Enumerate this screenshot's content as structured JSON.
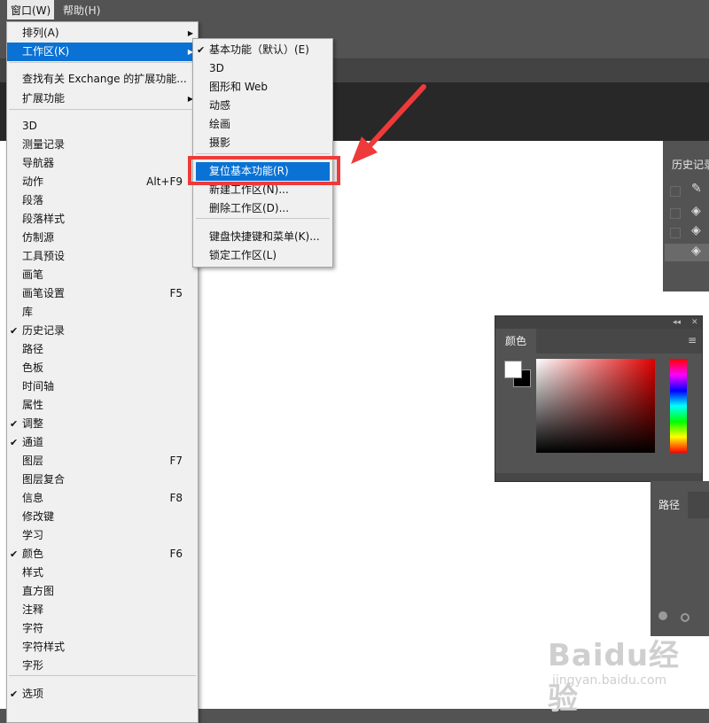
{
  "menubar": {
    "window": "窗口(W)",
    "help": "帮助(H)"
  },
  "window_menu": [
    {
      "label": "排列(A)",
      "submenu": true
    },
    {
      "label": "工作区(K)",
      "submenu": true,
      "highlighted": true
    },
    {
      "label": "查找有关 Exchange 的扩展功能..."
    },
    {
      "label": "扩展功能",
      "submenu": true
    },
    {
      "label": "3D"
    },
    {
      "label": "测量记录"
    },
    {
      "label": "导航器"
    },
    {
      "label": "动作",
      "shortcut": "Alt+F9"
    },
    {
      "label": "段落"
    },
    {
      "label": "段落样式"
    },
    {
      "label": "仿制源"
    },
    {
      "label": "工具预设"
    },
    {
      "label": "画笔"
    },
    {
      "label": "画笔设置",
      "shortcut": "F5"
    },
    {
      "label": "库"
    },
    {
      "label": "历史记录",
      "checked": true
    },
    {
      "label": "路径"
    },
    {
      "label": "色板"
    },
    {
      "label": "时间轴"
    },
    {
      "label": "属性"
    },
    {
      "label": "调整",
      "checked": true
    },
    {
      "label": "通道",
      "checked": true
    },
    {
      "label": "图层",
      "shortcut": "F7"
    },
    {
      "label": "图层复合"
    },
    {
      "label": "信息",
      "shortcut": "F8"
    },
    {
      "label": "修改键"
    },
    {
      "label": "学习"
    },
    {
      "label": "颜色",
      "shortcut": "F6",
      "checked": true
    },
    {
      "label": "样式"
    },
    {
      "label": "直方图"
    },
    {
      "label": "注释"
    },
    {
      "label": "字符"
    },
    {
      "label": "字符样式"
    },
    {
      "label": "字形"
    },
    {
      "label": "选项",
      "checked": true
    }
  ],
  "workspace_submenu": [
    {
      "label": "基本功能（默认）(E)",
      "checked": true
    },
    {
      "label": "3D"
    },
    {
      "label": "图形和 Web"
    },
    {
      "label": "动感"
    },
    {
      "label": "绘画"
    },
    {
      "label": "摄影"
    },
    {
      "label": "复位基本功能(R)",
      "highlighted": true
    },
    {
      "label": "新建工作区(N)..."
    },
    {
      "label": "删除工作区(D)..."
    },
    {
      "label": "键盘快捷键和菜单(K)..."
    },
    {
      "label": "锁定工作区(L)"
    }
  ],
  "panels": {
    "history": {
      "title": "历史记录"
    },
    "color": {
      "title": "颜色"
    },
    "paths": {
      "title": "路径"
    }
  },
  "icons": {
    "checkmark": "✔",
    "submenu_arrow": "▶",
    "panel_collapse": "◂◂",
    "panel_close": "✕",
    "panel_menu": "≡",
    "history_item": "brush-bucket-icon"
  },
  "colors": {
    "highlight": "#0a72d4",
    "callout": "#ee3a3a",
    "foreground": "#ffffff",
    "background": "#000000"
  },
  "watermark": {
    "logo": "Baidu经验",
    "url": "jingyan.baidu.com"
  }
}
